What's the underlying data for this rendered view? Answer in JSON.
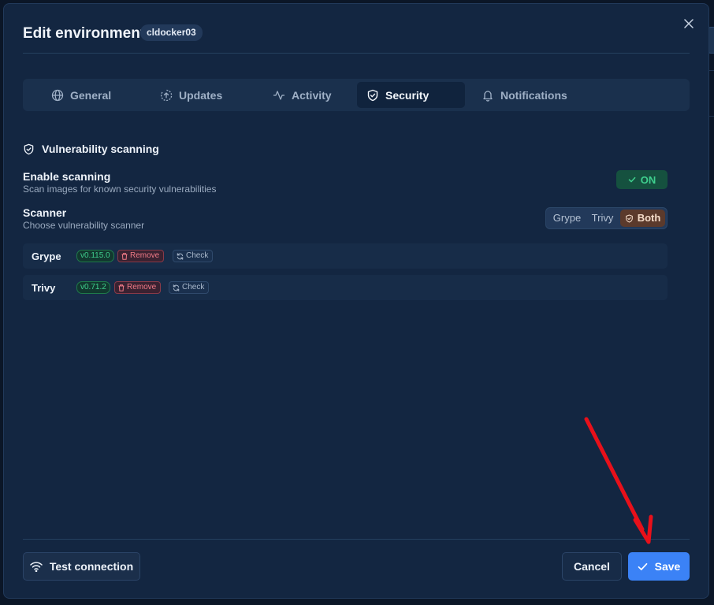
{
  "dialog": {
    "title": "Edit environment",
    "environment_badge": "cldocker03",
    "close_icon": "close-icon"
  },
  "tabs": [
    {
      "label": "General",
      "icon": "globe-icon",
      "active": false
    },
    {
      "label": "Updates",
      "icon": "circle-arrow-up-icon",
      "active": false
    },
    {
      "label": "Activity",
      "icon": "activity-pulse-icon",
      "active": false
    },
    {
      "label": "Security",
      "icon": "shield-check-icon",
      "active": true
    },
    {
      "label": "Notifications",
      "icon": "bell-icon",
      "active": false
    }
  ],
  "security": {
    "section_title": "Vulnerability scanning",
    "section_icon": "shield-check-icon",
    "enable_scanning": {
      "label": "Enable scanning",
      "description": "Scan images for known security vulnerabilities",
      "toggle_label": "ON",
      "enabled": true
    },
    "scanner": {
      "label": "Scanner",
      "description": "Choose vulnerability scanner",
      "options": [
        "Grype",
        "Trivy",
        "Both"
      ],
      "selected": "Both"
    },
    "scanners": [
      {
        "name": "Grype",
        "version": "v0.115.0",
        "remove_label": "Remove",
        "check_label": "Check"
      },
      {
        "name": "Trivy",
        "version": "v0.71.2",
        "remove_label": "Remove",
        "check_label": "Check"
      }
    ]
  },
  "footer": {
    "test_connection_label": "Test connection",
    "cancel_label": "Cancel",
    "save_label": "Save"
  },
  "colors": {
    "background": "#132641",
    "accent": "#3b82f6",
    "success": "#3fcf8e",
    "danger": "#f07a87",
    "annotation_arrow": "#e8101a"
  }
}
